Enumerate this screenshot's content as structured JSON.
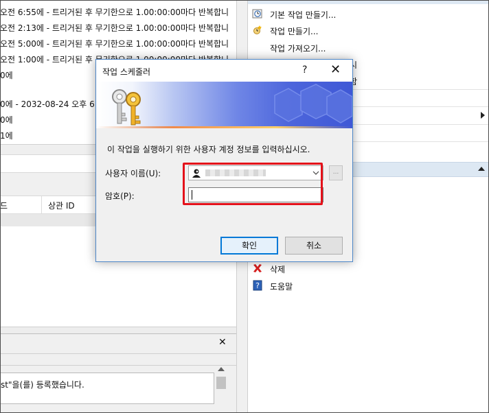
{
  "left_pane": {
    "trigger_rows": [
      "오전 6:55에 - 트리거된 후 무기한으로 1.00:00:00마다 반복합니",
      "오전 2:13에 - 트리거된 후 무기한으로 1.00:00:00마다 반복합니",
      "오전 5:00에 - 트리거된 후 무기한으로 1.00:00:00마다 반복합니",
      "오전 1:00에 - 트리거된 후 무기한으로 1.00:00:00마다 반복합니",
      "0에",
      "",
      "0에 - 2032-08-24 오후 6",
      "0에",
      "1에"
    ],
    "columns": [
      "드",
      "상관 ID"
    ],
    "history_text": "st\"을(를) 등록했습니다."
  },
  "actions": [
    {
      "label": "기본 작업 만들기...",
      "icon": "clock-task-icon"
    },
    {
      "label": "작업 만들기...",
      "icon": "new-task-icon"
    },
    {
      "label": "작업 가져오기...",
      "icon": ""
    },
    {
      "label": "시",
      "icon": ""
    },
    {
      "label": "함",
      "icon": ""
    },
    {
      "label": "삭제",
      "icon": "delete-icon"
    },
    {
      "label": "도움말",
      "icon": "help-icon"
    }
  ],
  "dialog": {
    "title": "작업 스케줄러",
    "help_glyph": "?",
    "description": "이 작업을 실행하기 위한 사용자 계정 정보를 입력하십시오.",
    "user_label": "사용자 이름(U):",
    "password_label": "암호(P):",
    "password_value": "",
    "browse_label": "...",
    "ok_label": "확인",
    "cancel_label": "취소"
  },
  "colors": {
    "highlight_box": "#e4111a",
    "default_button_border": "#0078d7",
    "actions_header": "#dde8f3"
  }
}
